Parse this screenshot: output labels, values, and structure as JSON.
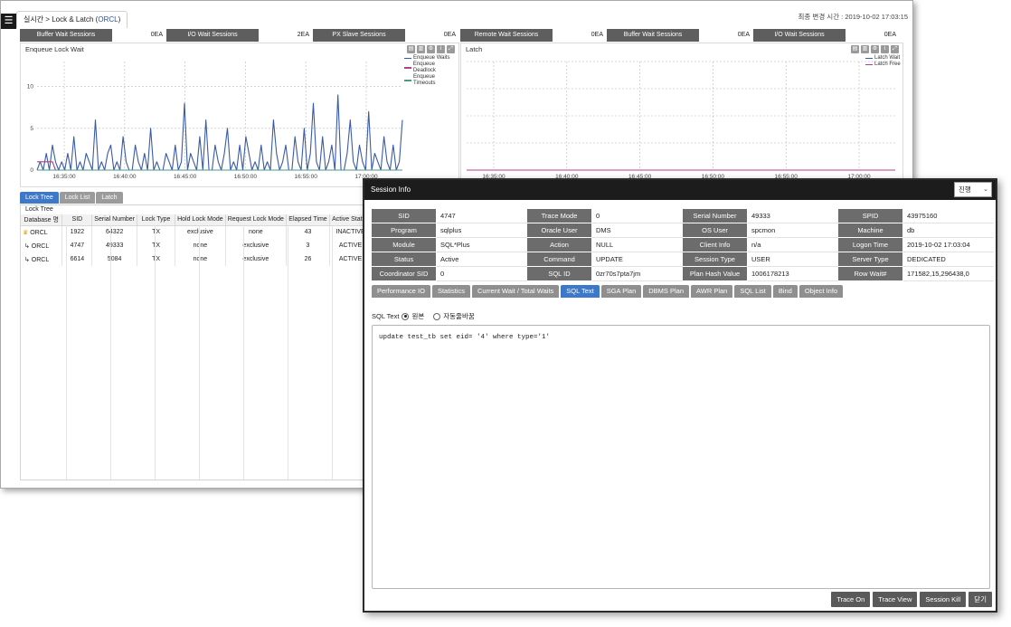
{
  "header": {
    "breadcrumb_prefix": "실시간 > Lock & Latch (",
    "breadcrumb_db": "ORCL",
    "breadcrumb_suffix": ")",
    "updated": "최종 변경 시간 : 2019-10-02 17:03:15"
  },
  "stats_left": [
    {
      "label": "Buffer Wait Sessions",
      "value": "0EA"
    },
    {
      "label": "I/O Wait Sessions",
      "value": "2EA"
    },
    {
      "label": "PX Slave Sessions",
      "value": "0EA"
    }
  ],
  "stats_right": [
    {
      "label": "Remote Wait Sessions",
      "value": "0EA"
    },
    {
      "label": "Buffer Wait Sessions",
      "value": "0EA"
    },
    {
      "label": "I/O Wait Sessions",
      "value": "0EA"
    }
  ],
  "chart_data": [
    {
      "type": "line",
      "title": "Enqueue Lock Wait",
      "x_ticks": [
        "16:35:00",
        "16:40:00",
        "16:45:00",
        "16:50:00",
        "16:55:00",
        "17:00:00"
      ],
      "y_ticks": [
        "0",
        "5",
        "10"
      ],
      "ylim": [
        0,
        13
      ],
      "grid": true,
      "legend_position": "top-right",
      "series": [
        {
          "name": "Enqueue Waits",
          "color": "#3a5ba8",
          "values": [
            0,
            1,
            0,
            2,
            0,
            3,
            1,
            0,
            1,
            0,
            2,
            0,
            4,
            0,
            1,
            0,
            2,
            1,
            0,
            6,
            0,
            1,
            0,
            2,
            3,
            0,
            1,
            0,
            4,
            1,
            0,
            0,
            3,
            1,
            0,
            2,
            0,
            5,
            0,
            1,
            0,
            0,
            2,
            1,
            0,
            3,
            0,
            1,
            8,
            0,
            2,
            1,
            0,
            4,
            0,
            6,
            0,
            0,
            3,
            1,
            0,
            2,
            5,
            0,
            1,
            0,
            3,
            0,
            4,
            2,
            0,
            1,
            0,
            3,
            0,
            1,
            0,
            6,
            2,
            0,
            1,
            3,
            0,
            0,
            4,
            1,
            0,
            5,
            0,
            2,
            8,
            1,
            0,
            4,
            0,
            1,
            3,
            0,
            9,
            0,
            0,
            2,
            6,
            1,
            0,
            3,
            1,
            0,
            7,
            0,
            2,
            1,
            0,
            4,
            1,
            0,
            3,
            0,
            1,
            6
          ]
        },
        {
          "name": "Enqueue Deadlock",
          "color": "#b23c8f",
          "values": [
            1,
            1,
            1,
            1,
            1,
            1,
            0,
            0,
            0,
            0,
            0,
            0,
            0,
            0,
            0,
            0,
            0,
            0,
            0,
            0,
            0,
            0,
            0,
            0,
            0,
            0,
            0,
            0,
            0,
            0,
            0,
            0,
            0,
            0,
            0,
            0,
            0,
            0,
            0,
            0,
            0,
            0,
            0,
            0,
            0,
            0,
            0,
            0,
            0,
            0,
            0,
            0,
            0,
            0,
            0,
            0,
            0,
            0,
            0,
            0,
            0,
            0,
            0,
            0,
            0,
            0,
            0,
            0,
            0,
            0,
            0,
            0,
            0,
            0,
            0,
            0,
            0,
            0,
            0,
            0,
            0,
            0,
            0,
            0,
            0,
            0,
            0,
            0,
            0,
            0,
            0,
            0,
            0,
            0,
            0,
            0,
            0,
            0,
            0,
            0,
            0,
            0,
            0,
            0,
            0,
            0,
            0,
            0,
            0,
            0,
            0,
            0,
            0,
            0,
            0,
            0,
            0,
            0,
            0,
            0
          ]
        },
        {
          "name": "Enqueue Timeouts",
          "color": "#4a9a8a",
          "values": [
            0,
            0,
            0,
            0,
            0,
            0,
            0,
            0,
            0,
            0,
            0,
            0,
            0,
            0,
            0,
            0,
            0,
            0,
            0,
            0,
            0,
            0,
            0,
            0,
            0,
            0,
            0,
            0,
            0,
            0,
            0,
            0,
            0,
            0,
            0,
            0,
            0,
            0,
            0,
            0,
            0,
            0,
            0,
            0,
            0,
            0,
            0,
            0,
            0,
            0,
            0,
            0,
            0,
            0,
            0,
            0,
            0,
            0,
            0,
            0,
            0,
            0,
            0,
            0,
            0,
            0,
            0,
            0,
            0,
            0,
            0,
            0,
            0,
            0,
            0,
            0,
            0,
            0,
            0,
            0,
            0,
            0,
            0,
            0,
            0,
            0,
            0,
            0,
            0,
            0,
            0,
            0,
            0,
            0,
            0,
            0,
            0,
            0,
            0,
            0,
            0,
            0,
            0,
            0,
            0,
            0,
            0,
            0,
            0,
            0,
            0,
            0,
            0,
            0,
            0,
            0,
            0,
            0,
            0,
            0
          ]
        }
      ]
    },
    {
      "type": "line",
      "title": "Latch",
      "x_ticks": [
        "16:35:00",
        "16:40:00",
        "16:45:00",
        "16:50:00",
        "16:55:00",
        "17:00:00"
      ],
      "ylim": [
        0,
        1
      ],
      "grid": true,
      "legend_position": "top-right",
      "series": [
        {
          "name": "Latch Wait",
          "color": "#3a5ba8",
          "values": [
            0,
            0,
            0,
            0,
            0,
            0,
            0,
            0,
            0,
            0,
            0
          ]
        },
        {
          "name": "Latch Free",
          "color": "#b23c8f",
          "values": [
            0,
            0,
            0,
            0,
            0,
            0,
            0,
            0,
            0,
            0,
            0
          ]
        }
      ]
    }
  ],
  "sub_tabs": [
    "Lock Tree",
    "Lock List",
    "Latch"
  ],
  "grid": {
    "caption": "Lock Tree",
    "columns": [
      "Database 명",
      "SID",
      "Serial Number",
      "Lock Type",
      "Hold Lock Mode",
      "Request Lock Mode",
      "Elapsed Time",
      "Active Status"
    ],
    "rows": [
      [
        "ORCL",
        "1922",
        "64322",
        "TX",
        "exclusive",
        "none",
        "43",
        "INACTIVE"
      ],
      [
        "ORCL",
        "4747",
        "49333",
        "TX",
        "none",
        "exclusive",
        "3",
        "ACTIVE"
      ],
      [
        "ORCL",
        "6614",
        "5084",
        "TX",
        "none",
        "exclusive",
        "26",
        "ACTIVE"
      ]
    ]
  },
  "modal": {
    "title": "Session Info",
    "select_value": "진행",
    "info": [
      [
        "SID",
        "4747",
        "Trace Mode",
        "0",
        "Serial Number",
        "49333",
        "SPID",
        "43975160"
      ],
      [
        "Program",
        "sqlplus",
        "Oracle User",
        "DMS",
        "OS User",
        "spcmon",
        "Machine",
        "db"
      ],
      [
        "Module",
        "SQL*Plus",
        "Action",
        "NULL",
        "Client Info",
        "n/a",
        "Logon Time",
        "2019-10-02 17:03:04"
      ],
      [
        "Status",
        "Active",
        "Command",
        "UPDATE",
        "Session Type",
        "USER",
        "Server Type",
        "DEDICATED"
      ],
      [
        "Coordinator SID",
        "0",
        "SQL ID",
        "0zr70s7pta7jm",
        "Plan Hash Value",
        "1006178213",
        "Row Wait#",
        "171582,15,296438,0"
      ]
    ],
    "tabs": [
      "Performance IO",
      "Statistics",
      "Current Wait / Total Waits",
      "SQL Text",
      "SGA Plan",
      "DBMS Plan",
      "AWR Plan",
      "SQL List",
      "Bind",
      "Object Info"
    ],
    "active_tab": "SQL Text",
    "sql_label": "SQL Text",
    "opt_original": "원본",
    "opt_autowrap": "자동줄바꿈",
    "sql_text": "update test_tb set eid= '4' where type='1'",
    "buttons": [
      "Trace On",
      "Trace View",
      "Session Kill",
      "닫기"
    ]
  }
}
